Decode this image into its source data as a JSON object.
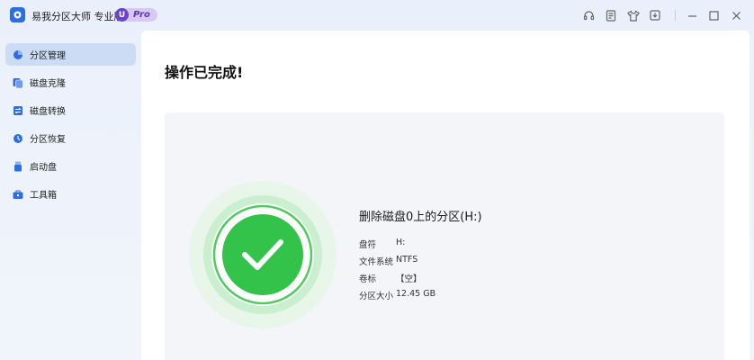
{
  "app": {
    "title": "易我分区大师 专业版",
    "badge_letter": "U",
    "badge_text": "Pro"
  },
  "window_controls": {
    "icons": [
      "headset-icon",
      "notes-icon",
      "shirt-icon",
      "download-icon",
      "minimize-icon",
      "maximize-icon",
      "close-icon"
    ]
  },
  "sidebar": {
    "items": [
      {
        "label": "分区管理",
        "icon": "partition-pie-icon",
        "active": true
      },
      {
        "label": "磁盘克隆",
        "icon": "disk-clone-icon",
        "active": false
      },
      {
        "label": "磁盘转换",
        "icon": "disk-convert-icon",
        "active": false
      },
      {
        "label": "分区恢复",
        "icon": "partition-recovery-icon",
        "active": false
      },
      {
        "label": "启动盘",
        "icon": "boot-usb-icon",
        "active": false
      },
      {
        "label": "工具箱",
        "icon": "toolbox-icon",
        "active": false
      }
    ]
  },
  "main": {
    "heading": "操作已完成!",
    "result": {
      "title": "删除磁盘0上的分区(H:)",
      "rows": [
        {
          "key": "盘符",
          "value": "H:"
        },
        {
          "key": "文件系统",
          "value": "NTFS"
        },
        {
          "key": "卷标",
          "value": "【空】"
        },
        {
          "key": "分区大小",
          "value": "12.45 GB"
        }
      ]
    }
  },
  "colors": {
    "accent": "#2d6fe0",
    "success": "#33c24a",
    "active_nav": "#cddcf5",
    "pro_purple": "#6a43c7"
  }
}
